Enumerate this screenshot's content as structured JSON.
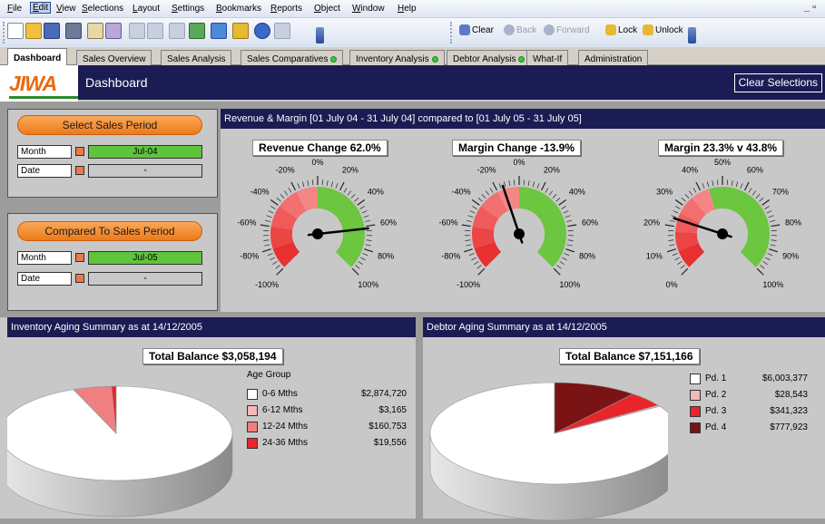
{
  "menu": {
    "items": [
      "File",
      "Edit",
      "View",
      "Selections",
      "Layout",
      "Settings",
      "Bookmarks",
      "Reports",
      "Object",
      "Window",
      "Help"
    ],
    "window_controls": "_ ▫"
  },
  "toolbar": {
    "clear": "Clear",
    "back": "Back",
    "forward": "Forward",
    "lock": "Lock",
    "unlock": "Unlock"
  },
  "tabs": [
    {
      "label": "Dashboard",
      "active": true,
      "dot": false
    },
    {
      "label": "Sales Overview",
      "dot": false
    },
    {
      "label": "Sales Analysis",
      "dot": false
    },
    {
      "label": "Sales Comparatives",
      "dot": true
    },
    {
      "label": "Inventory Analysis",
      "dot": true
    },
    {
      "label": "Debtor Analysis",
      "dot": true
    },
    {
      "label": "What-If",
      "dot": false
    },
    {
      "label": "Administration",
      "dot": false
    }
  ],
  "header": {
    "logo": "JIWA",
    "title": "Dashboard",
    "clear_selections": "Clear Selections"
  },
  "period": {
    "select_title": "Select Sales Period",
    "compare_title": "Compared To Sales Period",
    "month_label": "Month",
    "date_label": "Date",
    "select_month": "Jul-04",
    "compare_month": "Jul-05"
  },
  "gauges": {
    "header": "Revenue & Margin  [01 July 04 - 31 July 04]  compared to  [01 July 05 - 31 July 05]",
    "items": [
      {
        "title": "Revenue Change 62.0%",
        "ticks": [
          "-100%",
          "-80%",
          "-60%",
          "-40%",
          "-20%",
          "0%",
          "20%",
          "40%",
          "60%",
          "80%",
          "100%"
        ],
        "min": -100,
        "max": 100,
        "value": 62.0
      },
      {
        "title": "Margin Change -13.9%",
        "ticks": [
          "-100%",
          "-80%",
          "-60%",
          "-40%",
          "-20%",
          "0%",
          "20%",
          "40%",
          "60%",
          "80%",
          "100%"
        ],
        "min": -100,
        "max": 100,
        "value": -13.9
      },
      {
        "title": "Margin 23.3% v 43.8%",
        "ticks": [
          "0%",
          "10%",
          "20%",
          "30%",
          "40%",
          "50%",
          "60%",
          "70%",
          "80%",
          "90%",
          "100%"
        ],
        "min": 0,
        "max": 100,
        "value": 23.3
      }
    ]
  },
  "inventory": {
    "header": "Inventory Aging Summary as at 14/12/2005",
    "total": "Total Balance $3,058,194",
    "legend_title": "Age Group",
    "items": [
      {
        "name": "0-6 Mths",
        "value": "$2,874,720",
        "color": "#ffffff"
      },
      {
        "name": "6-12 Mths",
        "value": "$3,165",
        "color": "#f4b8b8"
      },
      {
        "name": "12-24 Mths",
        "value": "$160,753",
        "color": "#f08080"
      },
      {
        "name": "24-36 Mths",
        "value": "$19,556",
        "color": "#e8252a"
      }
    ]
  },
  "debtor": {
    "header": "Debtor Aging Summary as at 14/12/2005",
    "total": "Total Balance $7,151,166",
    "items": [
      {
        "name": "Pd. 1",
        "value": "$6,003,377",
        "color": "#ffffff"
      },
      {
        "name": "Pd. 2",
        "value": "$28,543",
        "color": "#f4b8b8"
      },
      {
        "name": "Pd. 3",
        "value": "$341,323",
        "color": "#e8252a"
      },
      {
        "name": "Pd. 4",
        "value": "$777,923",
        "color": "#7a1414"
      }
    ]
  },
  "chart_data": [
    {
      "type": "pie",
      "title": "Total Balance $3,058,194",
      "legend_title": "Age Group",
      "categories": [
        "0-6 Mths",
        "6-12 Mths",
        "12-24 Mths",
        "24-36 Mths"
      ],
      "values": [
        2874720,
        3165,
        160753,
        19556
      ]
    },
    {
      "type": "pie",
      "title": "Total Balance $7,151,166",
      "categories": [
        "Pd. 1",
        "Pd. 2",
        "Pd. 3",
        "Pd. 4"
      ],
      "values": [
        6003377,
        28543,
        341323,
        777923
      ]
    }
  ]
}
